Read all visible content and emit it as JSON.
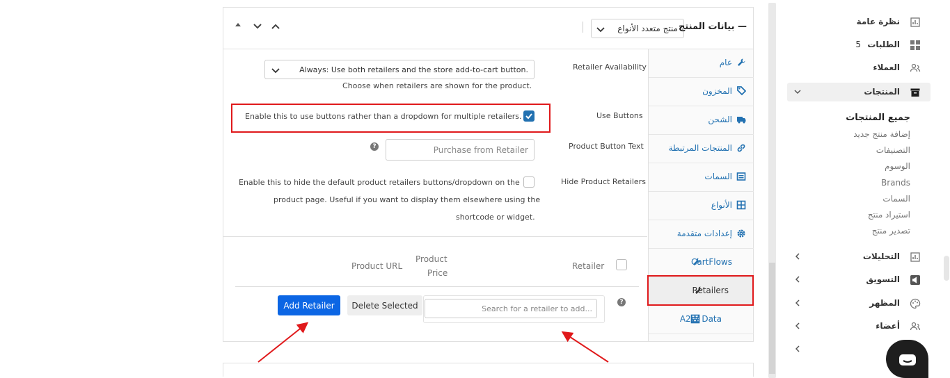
{
  "panel": {
    "title": "بيانات المنتج —",
    "product_type": "منتج متعدد الأنواع",
    "tabs": [
      {
        "label": "عام",
        "icon": "wrench-icon"
      },
      {
        "label": "المخزون",
        "icon": "tag-icon"
      },
      {
        "label": "الشحن",
        "icon": "truck-icon"
      },
      {
        "label": "المنتجات المرتبطة",
        "icon": "link-icon"
      },
      {
        "label": "السمات",
        "icon": "list-box-icon"
      },
      {
        "label": "الأنواع",
        "icon": "grid-icon"
      },
      {
        "label": "إعدادات متقدمة",
        "icon": "gear-icon"
      },
      {
        "label": "CartFlows",
        "icon": "wrench-icon"
      },
      {
        "label": "Retailers",
        "icon": "wrench-icon",
        "active": true
      },
      {
        "label": "A2W Data",
        "icon": "list-icon"
      }
    ]
  },
  "form": {
    "availability_label": "Retailer Availability",
    "availability_value": "Always: Use both retailers and the store add-to-cart button.",
    "availability_help": "Choose when retailers are shown for the product.",
    "use_buttons_label": "Use Buttons",
    "use_buttons_help": "Enable this to use buttons rather than a dropdown for multiple retailers.",
    "use_buttons_checked": true,
    "button_text_label": "Product Button Text",
    "button_text_placeholder": "Purchase from Retailer",
    "hide_label": "Hide Product Retailers",
    "hide_help_1": "Enable this to hide the default product retailers buttons/dropdown on the",
    "hide_help_2": "product page. Useful if you want to display them elsewhere using the",
    "hide_help_3": "shortcode or widget.",
    "hide_checked": false
  },
  "retailers_table": {
    "columns": [
      "Retailer",
      "Product Price",
      "Product URL"
    ],
    "col_price_1": "Product",
    "col_price_2": "Price",
    "search_placeholder": "Search for a retailer to add...",
    "delete_label": "Delete Selected",
    "add_label": "Add Retailer"
  },
  "sidebar": {
    "items": [
      {
        "label": "نظرة عامة",
        "icon": "chart-icon"
      },
      {
        "label": "الطلبات",
        "icon": "grid-icon",
        "count": "5"
      },
      {
        "label": "العملاء",
        "icon": "users-icon"
      },
      {
        "label": "المنتجات",
        "icon": "archive-icon",
        "active": true
      },
      {
        "label": "التحليلات",
        "icon": "chart-icon"
      },
      {
        "label": "التسويق",
        "icon": "megaphone-icon"
      },
      {
        "label": "المظهر",
        "icon": "palette-icon"
      },
      {
        "label": "أعضاء",
        "icon": "users-icon"
      }
    ],
    "sub_items": [
      "جميع المنتجات",
      "إضافة منتج جديد",
      "التصنيفات",
      "الوسوم",
      "Brands",
      "السمات",
      "استيراد منتج",
      "تصدير منتج"
    ]
  },
  "colors": {
    "accent": "#2271b1",
    "highlight": "#e0191b",
    "primary_button": "#0c66e4"
  }
}
